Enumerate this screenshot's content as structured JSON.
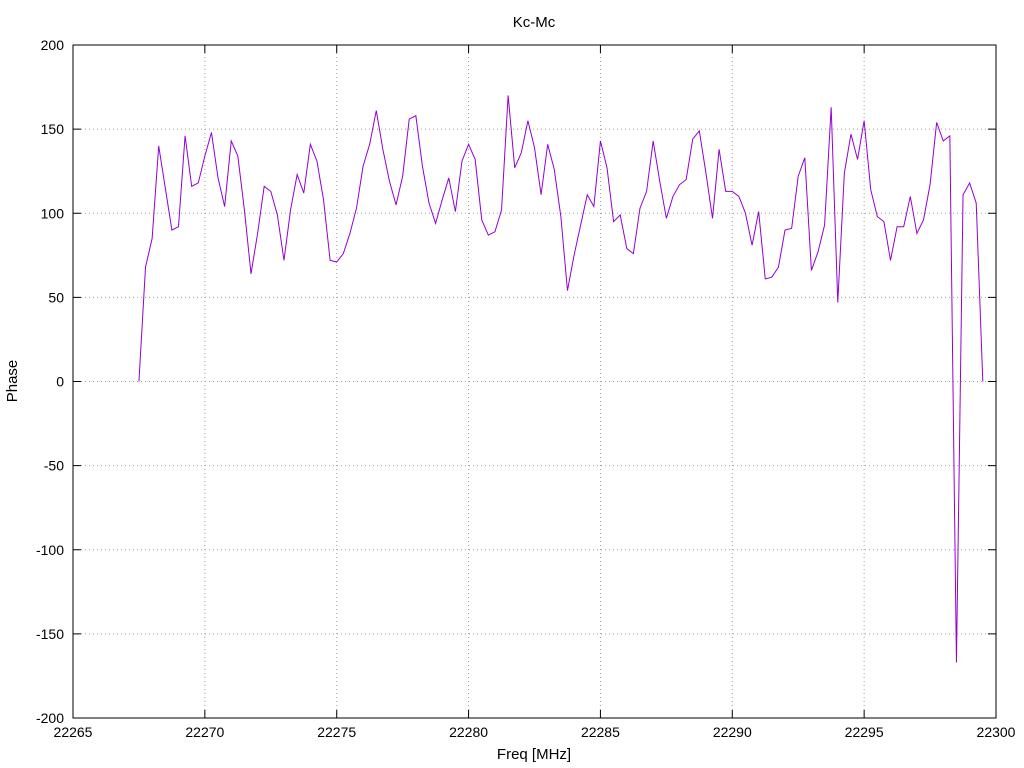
{
  "chart_data": {
    "type": "line",
    "title": "Kc-Mc",
    "xlabel": "Freq [MHz]",
    "ylabel": "Phase",
    "xlim": [
      22265,
      22300
    ],
    "ylim": [
      -200,
      200
    ],
    "x_ticks": [
      "22265",
      "22270",
      "22275",
      "22280",
      "22285",
      "22290",
      "22295",
      "22300"
    ],
    "y_ticks": [
      "200",
      "150",
      "100",
      "50",
      "0",
      "-50",
      "-100",
      "-150",
      "-200"
    ],
    "grid": true,
    "legend": "none",
    "series_color": "#9400d3",
    "series": [
      {
        "x": [
          22267.5,
          22267.75,
          22268.0,
          22268.25,
          22268.5,
          22268.75,
          22269.0,
          22269.25,
          22269.5,
          22269.75,
          22270.0,
          22270.25,
          22270.5,
          22270.75,
          22271.0,
          22271.25,
          22271.5,
          22271.75,
          22272.0,
          22272.25,
          22272.5,
          22272.75,
          22273.0,
          22273.25,
          22273.5,
          22273.75,
          22274.0,
          22274.25,
          22274.5,
          22274.75,
          22275.0,
          22275.25,
          22275.5,
          22275.75,
          22276.0,
          22276.25,
          22276.5,
          22276.75,
          22277.0,
          22277.25,
          22277.5,
          22277.75,
          22278.0,
          22278.25,
          22278.5,
          22278.75,
          22279.0,
          22279.25,
          22279.5,
          22279.75,
          22280.0,
          22280.25,
          22280.5,
          22280.75,
          22281.0,
          22281.25,
          22281.5,
          22281.75,
          22282.0,
          22282.25,
          22282.5,
          22282.75,
          22283.0,
          22283.25,
          22283.5,
          22283.75,
          22284.0,
          22284.25,
          22284.5,
          22284.75,
          22285.0,
          22285.25,
          22285.5,
          22285.75,
          22286.0,
          22286.25,
          22286.5,
          22286.75,
          22287.0,
          22287.25,
          22287.5,
          22287.75,
          22288.0,
          22288.25,
          22288.5,
          22288.75,
          22289.0,
          22289.25,
          22289.5,
          22289.75,
          22290.0,
          22290.25,
          22290.5,
          22290.75,
          22291.0,
          22291.25,
          22291.5,
          22291.75,
          22292.0,
          22292.25,
          22292.5,
          22292.75,
          22293.0,
          22293.25,
          22293.5,
          22293.75,
          22294.0,
          22294.25,
          22294.5,
          22294.75,
          22295.0,
          22295.25,
          22295.5,
          22295.75,
          22296.0,
          22296.25,
          22296.5,
          22296.75,
          22297.0,
          22297.25,
          22297.5,
          22297.75,
          22298.0,
          22298.25,
          22298.5,
          22298.75,
          22299.0,
          22299.25,
          22299.5
        ],
        "values": [
          0,
          68,
          85,
          140,
          115,
          90,
          92,
          146,
          116,
          118,
          134,
          148,
          121,
          104,
          143,
          134,
          102,
          64,
          88,
          116,
          113,
          99,
          72,
          102,
          123,
          112,
          141,
          131,
          108,
          72,
          71,
          76,
          88,
          103,
          128,
          141,
          161,
          138,
          119,
          105,
          122,
          156,
          158,
          128,
          106,
          94,
          108,
          121,
          101,
          131,
          141,
          132,
          96,
          87,
          89,
          102,
          170,
          127,
          136,
          155,
          139,
          111,
          141,
          126,
          98,
          54,
          75,
          93,
          111,
          104,
          143,
          127,
          95,
          99,
          79,
          76,
          103,
          113,
          143,
          119,
          97,
          110,
          117,
          120,
          144,
          149,
          124,
          97,
          138,
          113,
          113,
          110,
          100,
          81,
          101,
          61,
          62,
          68,
          90,
          91,
          122,
          133,
          66,
          77,
          93,
          163,
          47,
          124,
          147,
          132,
          155,
          114,
          98,
          95,
          72,
          92,
          92,
          110,
          88,
          96,
          117,
          154,
          143,
          146,
          -167,
          111,
          118,
          106,
          0
        ]
      }
    ]
  }
}
